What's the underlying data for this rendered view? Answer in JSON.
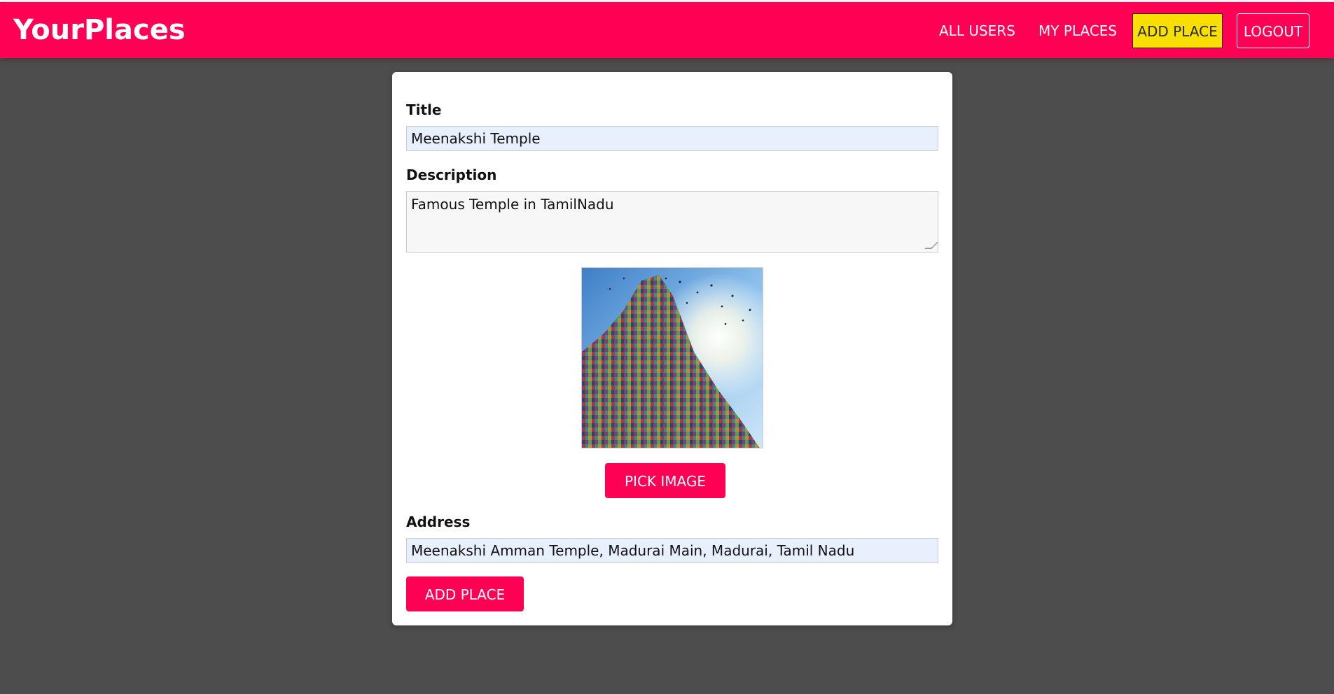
{
  "header": {
    "brand": "YourPlaces",
    "nav": {
      "all_users": "ALL USERS",
      "my_places": "MY PLACES",
      "add_place": "ADD PLACE",
      "logout": "LOGOUT"
    }
  },
  "form": {
    "title_label": "Title",
    "title_value": "Meenakshi Temple",
    "description_label": "Description",
    "description_value": "Famous Temple in TamilNadu",
    "image": {
      "pick_button": "PICK IMAGE"
    },
    "address_label": "Address",
    "address_value": "Meenakshi Amman Temple, Madurai Main, Madurai, Tamil Nadu",
    "submit_button": "ADD PLACE"
  },
  "colors": {
    "brand": "#ff0055",
    "active_nav": "#f8df00",
    "background": "#4d4d4d",
    "autofill": "#e8f0fe"
  }
}
